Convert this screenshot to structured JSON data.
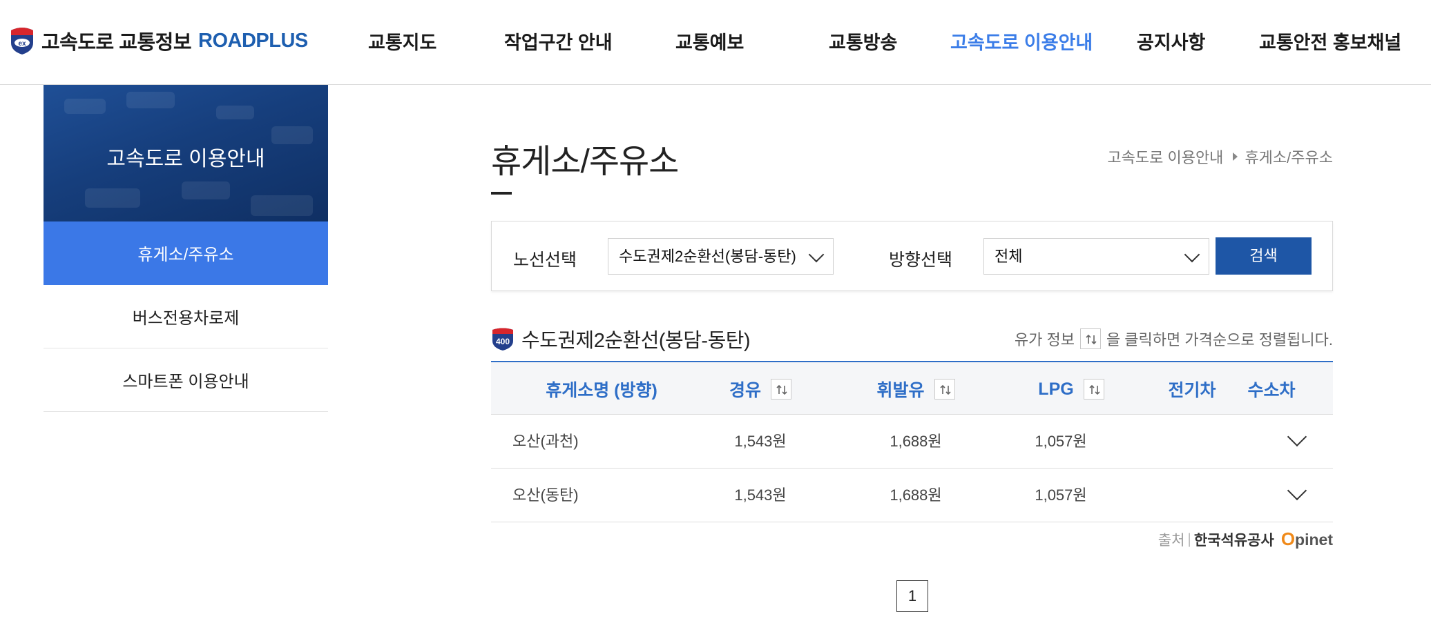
{
  "header": {
    "logo_text": "고속도로 교통정보",
    "logo_brand": "ROADPLUS",
    "nav": [
      {
        "label": "교통지도"
      },
      {
        "label": "작업구간 안내"
      },
      {
        "label": "교통예보"
      },
      {
        "label": "교통방송"
      },
      {
        "label": "고속도로 이용안내",
        "active": true
      },
      {
        "label": "공지사항"
      },
      {
        "label": "교통안전 홍보채널"
      }
    ]
  },
  "sidebar": {
    "banner_title": "고속도로 이용안내",
    "items": [
      {
        "label": "휴게소/주유소",
        "active": true
      },
      {
        "label": "버스전용차로제"
      },
      {
        "label": "스마트폰 이용안내"
      }
    ]
  },
  "main": {
    "title": "휴게소/주유소",
    "breadcrumb": [
      "고속도로 이용안내",
      "휴게소/주유소"
    ],
    "search": {
      "route_label": "노선선택",
      "route_value": "수도권제2순환선(봉담-동탄)",
      "direction_label": "방향선택",
      "direction_value": "전체",
      "button_label": "검색"
    },
    "route_heading": "수도권제2순환선(봉담-동탄)",
    "route_number": "400",
    "sort_hint_prefix": "유가 정보",
    "sort_hint_suffix": "을 클릭하면 가격순으로 정렬됩니다.",
    "table": {
      "headers": {
        "name": "휴게소명 (방향)",
        "diesel": "경유",
        "gasoline": "휘발유",
        "lpg": "LPG",
        "ev": "전기차",
        "hydrogen": "수소차"
      },
      "rows": [
        {
          "name": "오산(과천)",
          "diesel": "1,543원",
          "gasoline": "1,688원",
          "lpg": "1,057원"
        },
        {
          "name": "오산(동탄)",
          "diesel": "1,543원",
          "gasoline": "1,688원",
          "lpg": "1,057원"
        }
      ]
    },
    "source": {
      "label": "출처",
      "org": "한국석유공사",
      "brand_o": "O",
      "brand_rest": "pinet"
    },
    "pagination": {
      "current": "1"
    }
  },
  "colors": {
    "accent_blue": "#3b78e7",
    "button_blue": "#1e56a6",
    "header_text_blue": "#2e6ec7",
    "opinet_orange": "#f08a1a"
  }
}
